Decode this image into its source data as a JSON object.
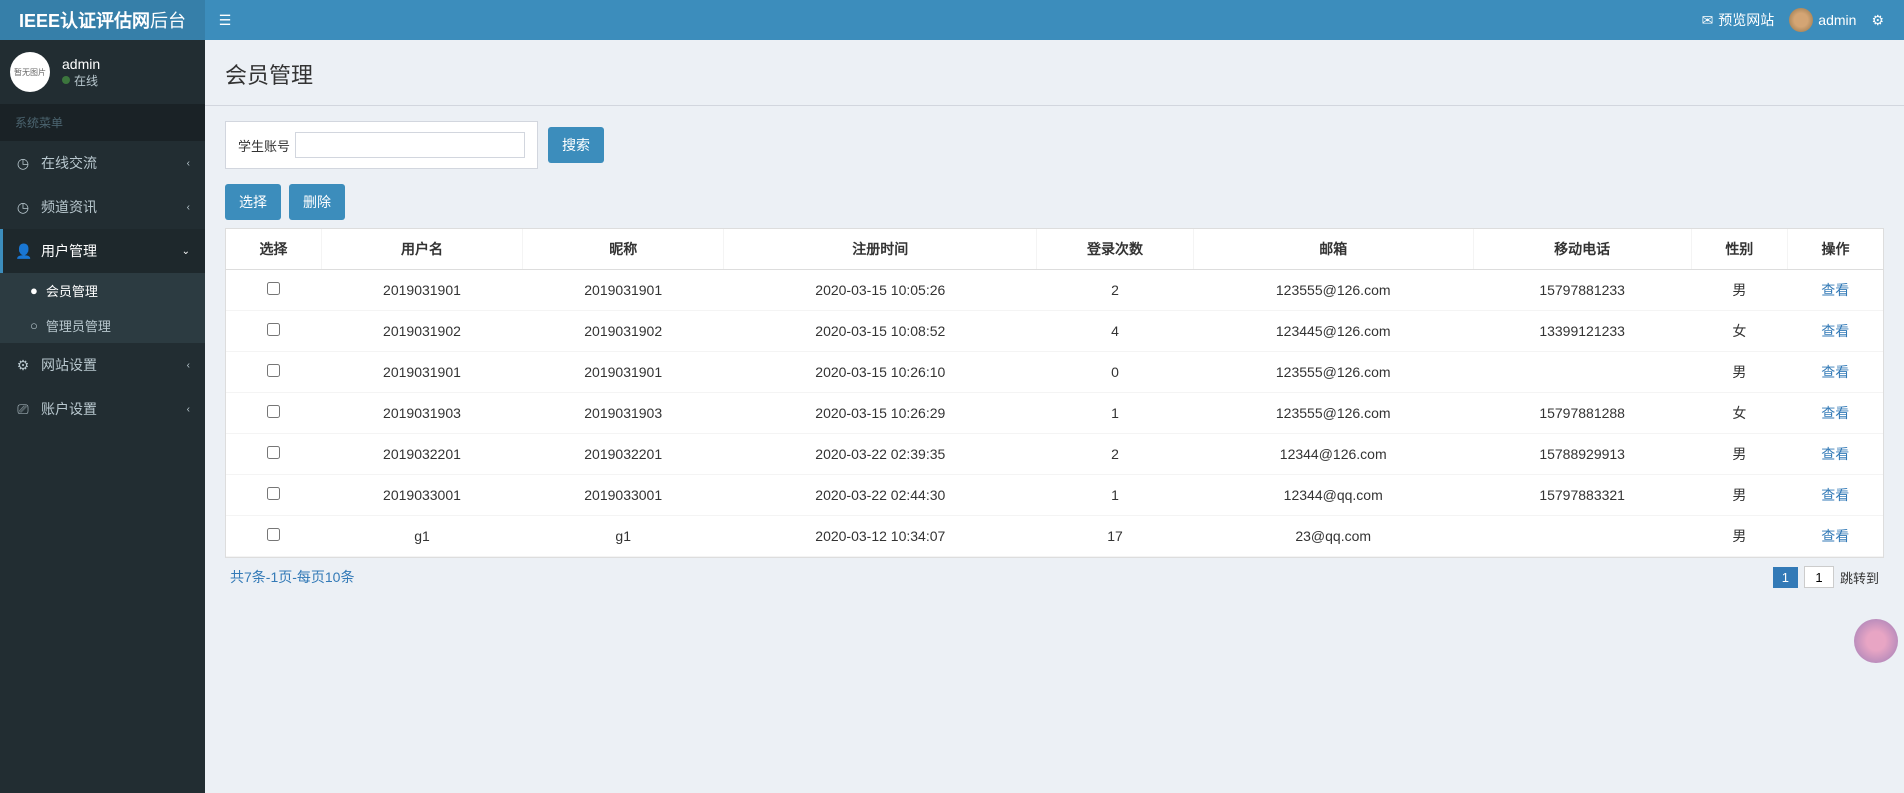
{
  "logo": {
    "title": "IEEE认证评估网",
    "suffix": "后台"
  },
  "topbar": {
    "preview": "预览网站",
    "username": "admin"
  },
  "sidebar": {
    "user": {
      "name": "admin",
      "status": "在线",
      "avatar_text": "暂无图片"
    },
    "menu_header": "系统菜单",
    "items": [
      {
        "label": "在线交流",
        "icon": "◷"
      },
      {
        "label": "频道资讯",
        "icon": "◷"
      },
      {
        "label": "用户管理",
        "icon": "👤",
        "expanded": true,
        "children": [
          {
            "label": "会员管理",
            "active": true
          },
          {
            "label": "管理员管理"
          }
        ]
      },
      {
        "label": "网站设置",
        "icon": "⚙"
      },
      {
        "label": "账户设置",
        "icon": "⎚"
      }
    ]
  },
  "page": {
    "title": "会员管理"
  },
  "search": {
    "label": "学生账号",
    "button": "搜索"
  },
  "actions": {
    "select": "选择",
    "delete": "删除"
  },
  "table": {
    "headers": [
      "选择",
      "用户名",
      "昵称",
      "注册时间",
      "登录次数",
      "邮箱",
      "移动电话",
      "性别",
      "操作"
    ],
    "view_label": "查看",
    "rows": [
      {
        "username": "2019031901",
        "nickname": "2019031901",
        "reg": "2020-03-15 10:05:26",
        "logins": "2",
        "email": "123555@126.com",
        "phone": "15797881233",
        "gender": "男"
      },
      {
        "username": "2019031902",
        "nickname": "2019031902",
        "reg": "2020-03-15 10:08:52",
        "logins": "4",
        "email": "123445@126.com",
        "phone": "13399121233",
        "gender": "女"
      },
      {
        "username": "2019031901",
        "nickname": "2019031901",
        "reg": "2020-03-15 10:26:10",
        "logins": "0",
        "email": "123555@126.com",
        "phone": "",
        "gender": "男"
      },
      {
        "username": "2019031903",
        "nickname": "2019031903",
        "reg": "2020-03-15 10:26:29",
        "logins": "1",
        "email": "123555@126.com",
        "phone": "15797881288",
        "gender": "女"
      },
      {
        "username": "2019032201",
        "nickname": "2019032201",
        "reg": "2020-03-22 02:39:35",
        "logins": "2",
        "email": "12344@126.com",
        "phone": "15788929913",
        "gender": "男"
      },
      {
        "username": "2019033001",
        "nickname": "2019033001",
        "reg": "2020-03-22 02:44:30",
        "logins": "1",
        "email": "12344@qq.com",
        "phone": "15797883321",
        "gender": "男"
      },
      {
        "username": "g1",
        "nickname": "g1",
        "reg": "2020-03-12 10:34:07",
        "logins": "17",
        "email": "23@qq.com",
        "phone": "",
        "gender": "男"
      }
    ]
  },
  "pagination": {
    "info": "共7条-1页-每页10条",
    "current": "1",
    "input_value": "1",
    "jump": "跳转到"
  }
}
